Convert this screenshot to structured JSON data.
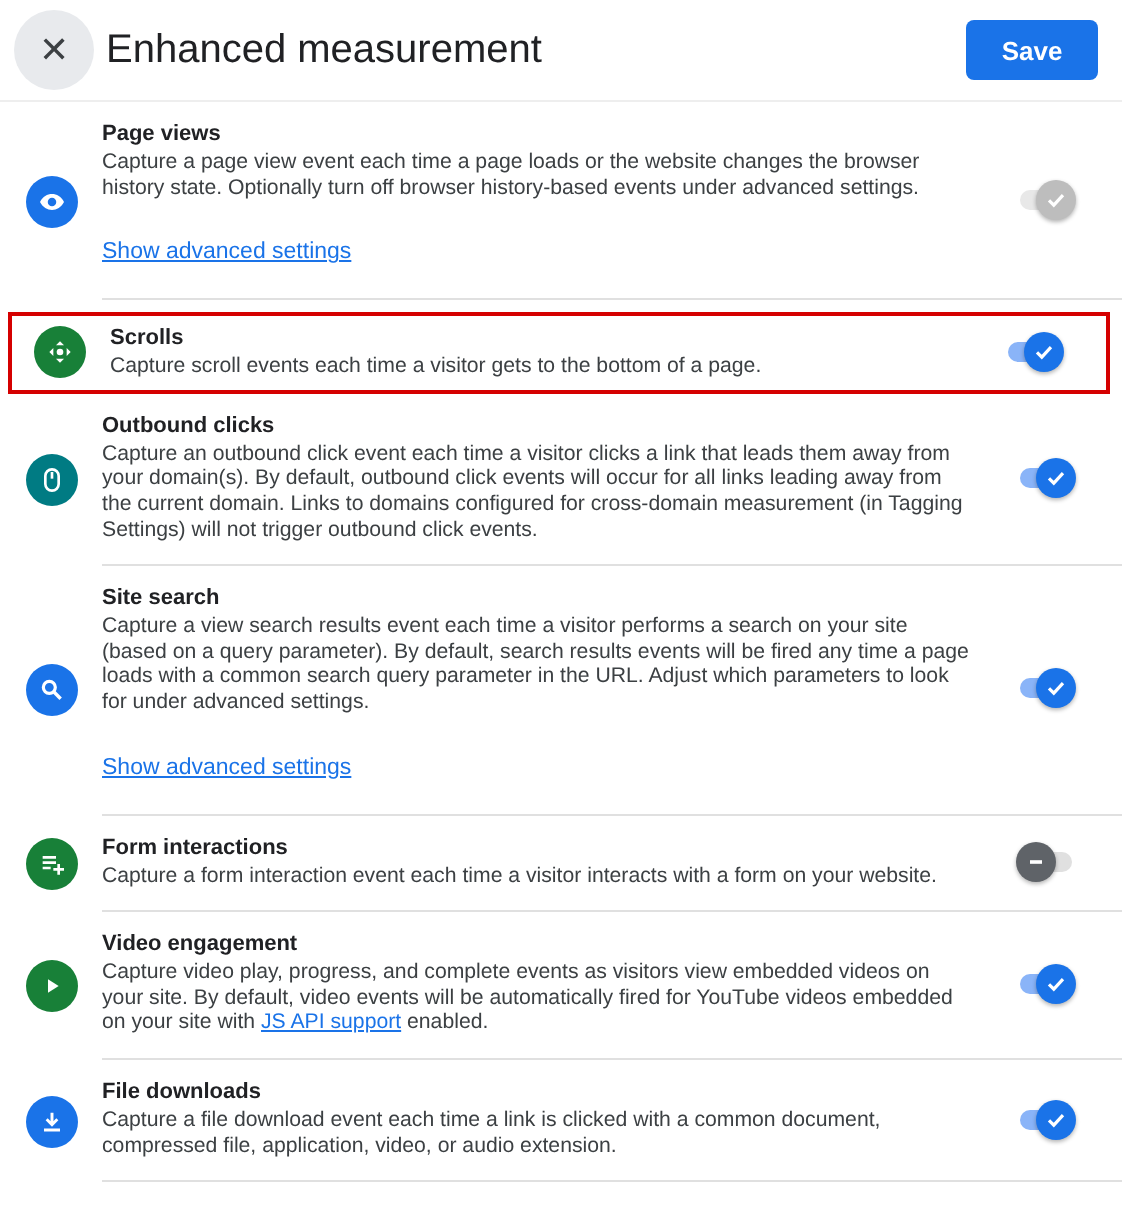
{
  "header": {
    "close_icon": "✕",
    "title": "Enhanced measurement",
    "save": "Save"
  },
  "settings": [
    {
      "kind": "eye",
      "color": "#1a73e8",
      "title": "Page views",
      "description": "Capture a page view event each time a page loads or the website changes the browser history state. Optionally turn off browser history-based events under advanced settings.",
      "advanced_link": "Show advanced settings",
      "on": true,
      "disabled": true,
      "highlighted": false
    },
    {
      "kind": "scroll",
      "color": "#188038",
      "title": "Scrolls",
      "description": "Capture scroll events each time a visitor gets to the bottom of a page.",
      "on": true,
      "disabled": false,
      "highlighted": true
    },
    {
      "kind": "mouse",
      "color": "#007b83",
      "title": "Outbound clicks",
      "description": "Capture an outbound click event each time a visitor clicks a link that leads them away from your domain(s). By default, outbound click events will occur for all links leading away from the current domain. Links to domains configured for cross-domain measurement (in Tagging Settings) will not trigger outbound click events.",
      "on": true,
      "disabled": false,
      "highlighted": false
    },
    {
      "kind": "search",
      "color": "#1a73e8",
      "title": "Site search",
      "description": "Capture a view search results event each time a visitor performs a search on your site (based on a query parameter). By default, search results events will be fired any time a page loads with a common search query parameter in the URL. Adjust which parameters to look for under advanced settings.",
      "advanced_link": "Show advanced settings",
      "on": true,
      "disabled": false,
      "highlighted": false
    },
    {
      "kind": "form",
      "color": "#188038",
      "title": "Form interactions",
      "description": "Capture a form interaction event each time a visitor interacts with a form on your website.",
      "on": false,
      "disabled": false,
      "highlighted": false
    },
    {
      "kind": "video",
      "color": "#188038",
      "title": "Video engagement",
      "description": "Capture video play, progress, and complete events as visitors view embedded videos on your site. By default, video events will be automatically fired for YouTube videos embedded on your site with",
      "description_link": "JS API support",
      "description_end": "enabled.",
      "on": true,
      "disabled": false,
      "highlighted": false
    },
    {
      "kind": "download",
      "color": "#1a73e8",
      "title": "File downloads",
      "description": "Capture a file download event each time a link is clicked with a common document, compressed file, application, video, or audio extension.",
      "on": true,
      "disabled": false,
      "highlighted": false
    }
  ]
}
